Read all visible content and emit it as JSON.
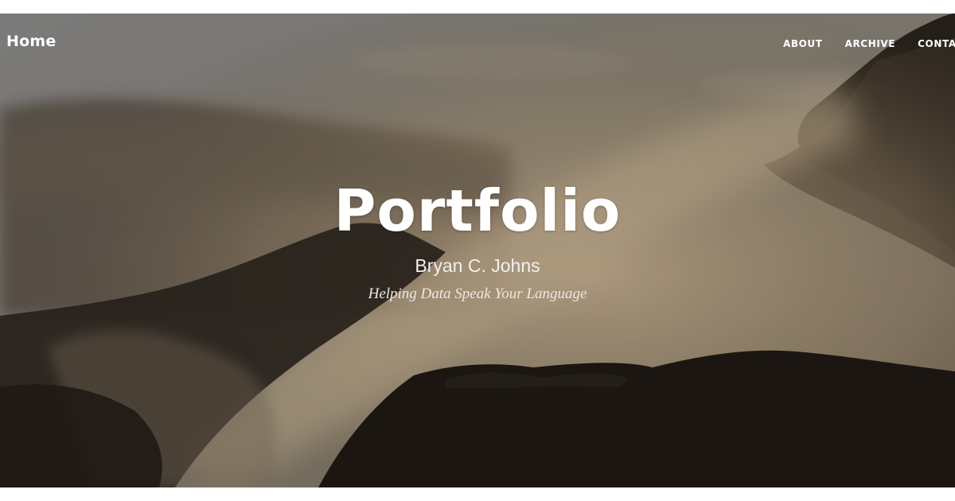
{
  "nav": {
    "brand": "Home",
    "links": [
      {
        "label": "ABOUT"
      },
      {
        "label": "ARCHIVE"
      },
      {
        "label": "CONTACT"
      }
    ]
  },
  "hero": {
    "title": "Portfolio",
    "subtitle": "Bryan C. Johns",
    "tagline": "Helping Data Speak Your Language"
  },
  "colors": {
    "text": "#ffffff",
    "sky": "#8a8a8a",
    "mist": "#b39e80",
    "mountain": "#1f1a15"
  }
}
